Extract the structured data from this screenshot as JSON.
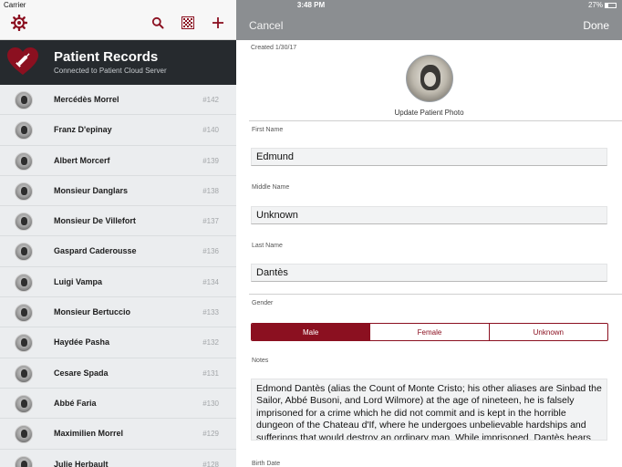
{
  "status_bar": {
    "carrier": "Carrier",
    "time": "3:48 PM",
    "battery": "27%"
  },
  "left_nav": {
    "icons": [
      "gear-icon",
      "search-icon",
      "qr-code-icon",
      "add-icon"
    ]
  },
  "header": {
    "title": "Patient Records",
    "subtitle": "Connected to Patient Cloud Server"
  },
  "patients": [
    {
      "name": "Mercédès Morrel",
      "number": "#142"
    },
    {
      "name": "Franz D'epinay",
      "number": "#140"
    },
    {
      "name": "Albert Morcerf",
      "number": "#139"
    },
    {
      "name": "Monsieur Danglars",
      "number": "#138"
    },
    {
      "name": "Monsieur De Villefort",
      "number": "#137"
    },
    {
      "name": "Gaspard Caderousse",
      "number": "#136"
    },
    {
      "name": "Luigi Vampa",
      "number": "#134"
    },
    {
      "name": "Monsieur  Bertuccio",
      "number": "#133"
    },
    {
      "name": "Haydée Pasha",
      "number": "#132"
    },
    {
      "name": "Cesare Spada",
      "number": "#131"
    },
    {
      "name": "Abbé Faria",
      "number": "#130"
    },
    {
      "name": "Maximilien Morrel",
      "number": "#129"
    },
    {
      "name": "Julie Herbault",
      "number": "#128"
    }
  ],
  "detail": {
    "cancel_label": "Cancel",
    "done_label": "Done",
    "created": "Created 1/30/17",
    "update_photo_label": "Update Patient Photo",
    "first_name_label": "First Name",
    "first_name": "Edmund",
    "middle_name_label": "Middle Name",
    "middle_name": "Unknown",
    "last_name_label": "Last Name",
    "last_name": "Dantès",
    "gender_label": "Gender",
    "gender_options": [
      "Male",
      "Female",
      "Unknown"
    ],
    "gender_selected": "Male",
    "notes_label": "Notes",
    "notes": "Edmond Dantès (alias the Count of Monte Cristo; his other aliases are Sinbad the Sailor, Abbé Busoni, and Lord Wilmore) at the age of nineteen, he is falsely imprisoned for a crime which he did not commit and is kept in the horrible dungeon of the Chateau d'If, where he undergoes unbelievable hardships and sufferings that would destroy an ordinary man. While imprisoned, Dantès hears",
    "birth_date_label": "Birth Date"
  },
  "colors": {
    "accent": "#8b1020",
    "header_dark": "#262a2e",
    "detail_nav": "#8b8e91",
    "list_bg": "#ebedef"
  }
}
